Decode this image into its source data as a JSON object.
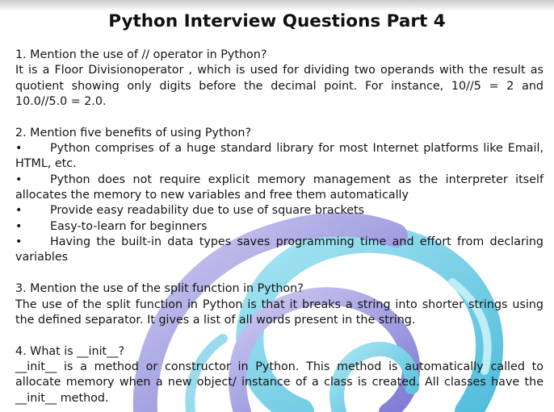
{
  "title": "Python Interview Questions Part 4",
  "sections": [
    {
      "question": "1. Mention the use of // operator in Python?",
      "answer": "It is a Floor Divisionoperator , which is used for dividing two operands with the result as quotient showing only digits before the decimal point. For instance, 10//5 = 2 and 10.0//5.0 = 2.0."
    },
    {
      "question": "2. Mention five benefits of using Python?",
      "bullets": [
        "Python comprises of a huge standard library for most Internet platforms like Email, HTML, etc.",
        "Python does not require explicit memory management as the interpreter itself allocates the memory to new variables and free them automatically",
        "Provide easy readability due to use of square brackets",
        "Easy-to-learn for beginners",
        "Having the built-in data types saves programming time and effort from declaring variables"
      ]
    },
    {
      "question": "3. Mention the use of the split function in Python?",
      "answer": "The use of the split function in Python is that it breaks a string into shorter strings using the defined separator. It gives a list of all words present in the string."
    },
    {
      "question": "4. What is __init__?",
      "answer": "__init__ is a method or constructor in Python. This method is automatically called to allocate memory when a new object/ instance of a class is created. All classes have the __init__ method."
    }
  ],
  "bullet_symbol": "•",
  "colors": {
    "text": "#141414",
    "swirl_blue": "#5ec8e0",
    "swirl_purple": "#8d8ad8"
  }
}
